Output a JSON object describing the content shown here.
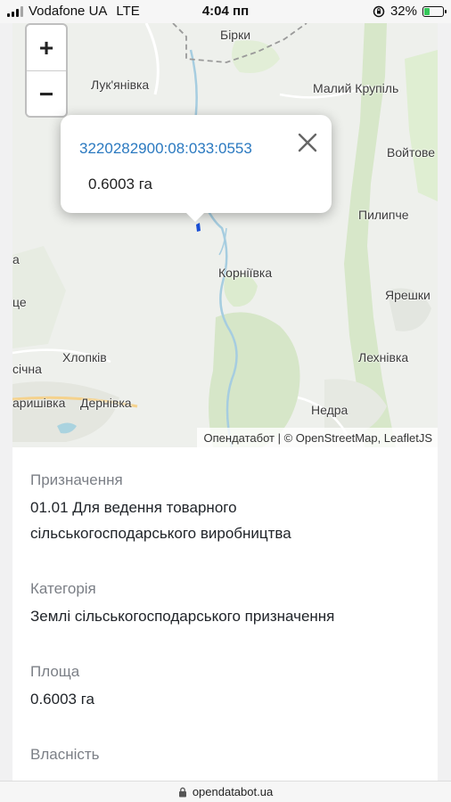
{
  "status_bar": {
    "carrier": "Vodafone UA",
    "network": "LTE",
    "time": "4:04 пп",
    "battery": "32%",
    "battery_level": 0.32,
    "battery_color": "#34c759"
  },
  "map": {
    "zoom_in": "+",
    "zoom_out": "−",
    "places": {
      "birky": "Бірки",
      "lukianivka": "Лук'янівка",
      "malyi_krupil": "Малий Крупіль",
      "voitove": "Войтове",
      "pylypche": "Пилипче",
      "korniivka": "Корніївка",
      "yareshky": "Ярешки",
      "lekhnivka": "Лехнівка",
      "khlopkiv": "Хлопків",
      "dernivka": "Дернівка",
      "nedra": "Недра",
      "edge_a": "а",
      "edge_tse": "це",
      "edge_sichna": "січна",
      "edge_baryshivka": "аришівка"
    },
    "popup": {
      "cadastral_number": "3220282900:08:033:0553",
      "area": "0.6003 га",
      "close_icon": "close-icon",
      "link_color": "#2a79c0"
    },
    "attribution": "Опендатабот | © OpenStreetMap, LeafletJS",
    "marker_color": "#1a4fd6"
  },
  "details": {
    "purpose_label": "Призначення",
    "purpose_line1": "01.01 Для ведення товарного",
    "purpose_line2": "сільськогосподарського виробництва",
    "category_label": "Категорія",
    "category_value": "Землі сільськогосподарського призначення",
    "area_label": "Площа",
    "area_value": "0.6003 га",
    "ownership_label": "Власність"
  },
  "browser": {
    "url": "opendatabot.ua",
    "lock_icon": "lock-icon"
  }
}
